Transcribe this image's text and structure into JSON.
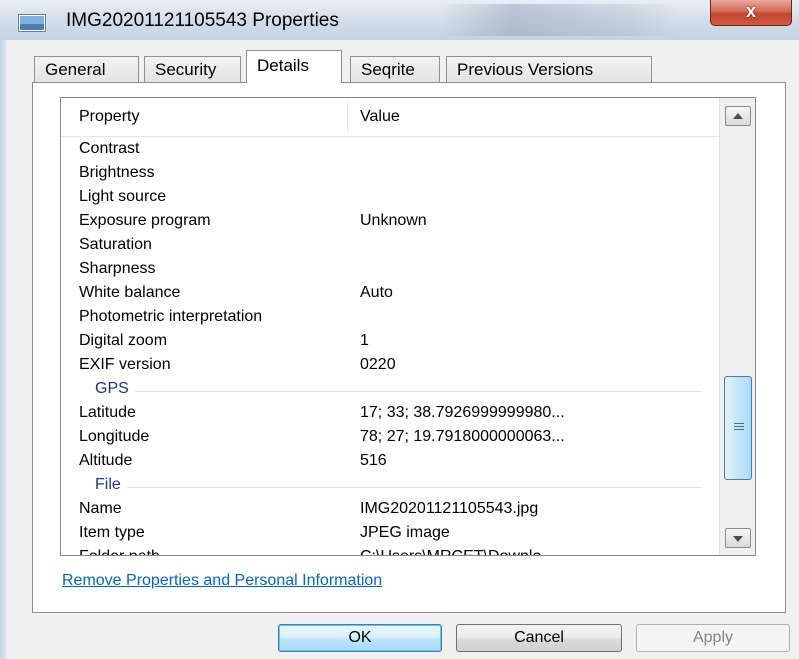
{
  "window": {
    "title": "IMG20201121105543 Properties",
    "close_glyph": "x"
  },
  "tabs": [
    {
      "label": "General"
    },
    {
      "label": "Security"
    },
    {
      "label": "Details"
    },
    {
      "label": "Seqrite"
    },
    {
      "label": "Previous Versions"
    }
  ],
  "active_tab": "Details",
  "list": {
    "headers": {
      "property": "Property",
      "value": "Value"
    },
    "rows": [
      {
        "property": "Contrast",
        "value": ""
      },
      {
        "property": "Brightness",
        "value": ""
      },
      {
        "property": "Light source",
        "value": ""
      },
      {
        "property": "Exposure program",
        "value": "Unknown"
      },
      {
        "property": "Saturation",
        "value": ""
      },
      {
        "property": "Sharpness",
        "value": ""
      },
      {
        "property": "White balance",
        "value": "Auto"
      },
      {
        "property": "Photometric interpretation",
        "value": ""
      },
      {
        "property": "Digital zoom",
        "value": "1"
      },
      {
        "property": "EXIF version",
        "value": "0220"
      }
    ],
    "groups": [
      {
        "name": "GPS",
        "rows": [
          {
            "property": "Latitude",
            "value": "17; 33; 38.7926999999980..."
          },
          {
            "property": "Longitude",
            "value": "78; 27; 19.7918000000063..."
          },
          {
            "property": "Altitude",
            "value": "516"
          }
        ]
      },
      {
        "name": "File",
        "rows": [
          {
            "property": "Name",
            "value": "IMG20201121105543.jpg"
          },
          {
            "property": "Item type",
            "value": "JPEG image"
          },
          {
            "property": "Folder path",
            "value": "C:\\Users\\MRCET\\Downlo..."
          }
        ]
      }
    ]
  },
  "remove_link": "Remove Properties and Personal Information",
  "buttons": {
    "ok": "OK",
    "cancel": "Cancel",
    "apply": "Apply"
  },
  "colors": {
    "link": "#0066cc",
    "group_heading": "#1e3287",
    "close_button": "#c2452f"
  }
}
